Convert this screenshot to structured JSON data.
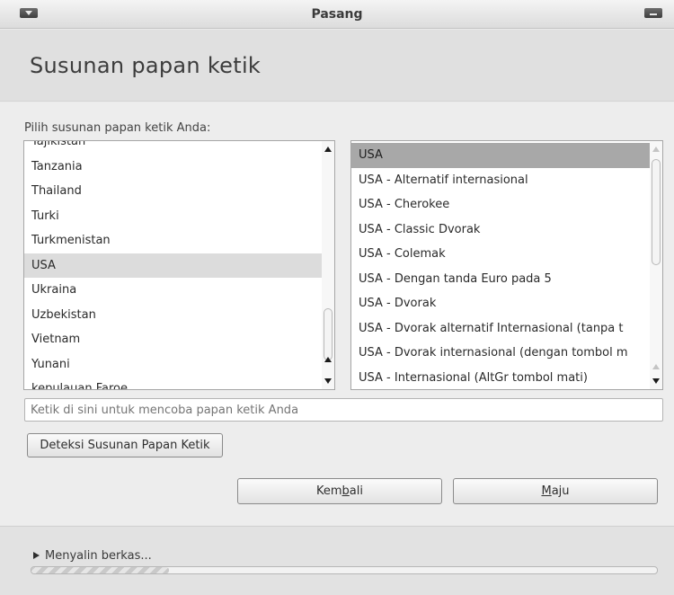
{
  "window": {
    "title": "Pasang"
  },
  "header": {
    "title": "Susunan papan ketik"
  },
  "prompt": "Pilih susunan papan ketik Anda:",
  "layouts": {
    "items": [
      "Tajikistan",
      "Tanzania",
      "Thailand",
      "Turki",
      "Turkmenistan",
      "USA",
      "Ukraina",
      "Uzbekistan",
      "Vietnam",
      "Yunani",
      "kepulauan Faroe"
    ],
    "selected": "USA"
  },
  "variants": {
    "items": [
      "USA",
      "USA - Alternatif internasional",
      "USA - Cherokee",
      "USA - Classic Dvorak",
      "USA - Colemak",
      "USA - Dengan tanda Euro pada 5",
      "USA - Dvorak",
      "USA - Dvorak alternatif Internasional (tanpa t",
      "USA - Dvorak internasional (dengan tombol m",
      "USA - Internasional (AltGr tombol mati)"
    ],
    "selected": "USA"
  },
  "test_input": {
    "placeholder": "Ketik di sini untuk mencoba papan ketik Anda"
  },
  "buttons": {
    "detect": "Deteksi Susunan Papan Ketik",
    "back_pre": "Kem",
    "back_mn": "b",
    "back_post": "ali",
    "next_mn": "M",
    "next_post": "aju"
  },
  "footer": {
    "status": "Menyalin berkas..."
  },
  "progress": {
    "fraction": 0.22
  },
  "icons": {
    "window_menu": "window-menu-icon",
    "window_minimize": "window-minimize-icon",
    "expander": "expander-arrow-icon"
  },
  "colors": {
    "selected_variant": "#a8a8a8",
    "selected_layout": "#dcdcdc"
  }
}
